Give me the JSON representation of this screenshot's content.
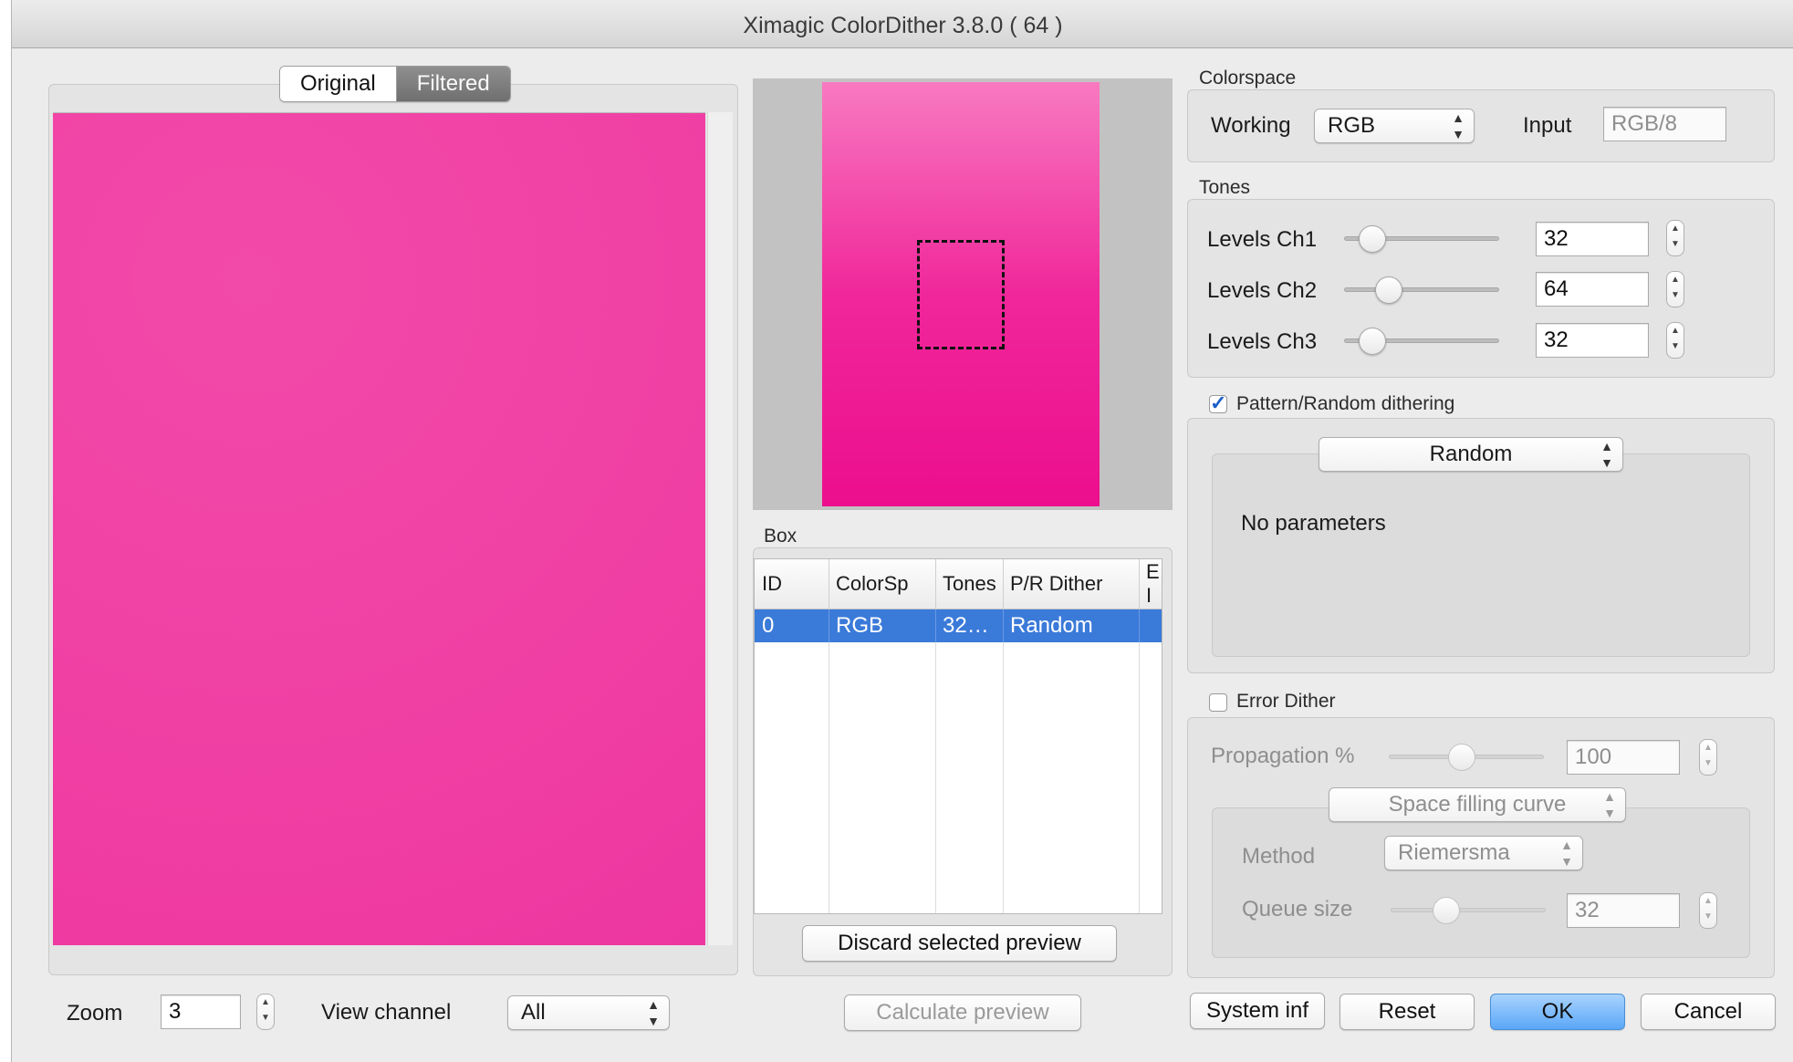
{
  "window": {
    "title": "Ximagic ColorDither 3.8.0 ( 64 )"
  },
  "view_toggle": {
    "original_label": "Original",
    "filtered_label": "Filtered"
  },
  "preview_colors": {
    "image_fill": "#f13fa5",
    "navigator_top": "#f879c0",
    "navigator_bottom": "#ec0e8e"
  },
  "bottom_left": {
    "zoom_label": "Zoom",
    "zoom_value": "3",
    "view_channel_label": "View channel",
    "view_channel_value": "All"
  },
  "box": {
    "label": "Box",
    "columns": [
      "ID",
      "ColorSp",
      "Tones",
      "P/R Dither",
      "E I"
    ],
    "rows": [
      [
        "0",
        "RGB",
        "32…",
        "Random",
        ""
      ]
    ],
    "discard_label": "Discard selected preview"
  },
  "calculate_preview_label": "Calculate preview",
  "colorspace": {
    "label": "Colorspace",
    "working_label": "Working",
    "working_value": "RGB",
    "input_label": "Input",
    "input_value": "RGB/8"
  },
  "tones": {
    "label": "Tones",
    "channels": [
      {
        "label": "Levels Ch1",
        "value": "32",
        "slider_pos": 0.18
      },
      {
        "label": "Levels Ch2",
        "value": "64",
        "slider_pos": 0.29
      },
      {
        "label": "Levels Ch3",
        "value": "32",
        "slider_pos": 0.18
      }
    ]
  },
  "pattern": {
    "checkbox_label": "Pattern/Random dithering",
    "checked": true,
    "mode_value": "Random",
    "params_text": "No parameters"
  },
  "error_dither": {
    "checkbox_label": "Error Dither",
    "checked": false,
    "propagation_label": "Propagation %",
    "propagation_value": "100",
    "propagation_slider_pos": 0.47,
    "curve_value": "Space filling curve",
    "method_label": "Method",
    "method_value": "Riemersma",
    "queue_label": "Queue size",
    "queue_value": "32",
    "queue_slider_pos": 0.36
  },
  "buttons": {
    "system_info": "System inf",
    "reset": "Reset",
    "ok": "OK",
    "cancel": "Cancel"
  }
}
